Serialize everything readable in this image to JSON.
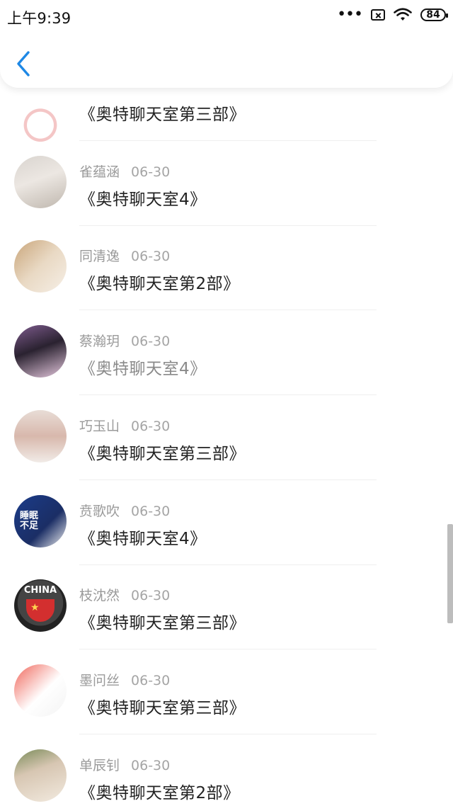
{
  "status_bar": {
    "time": "上午9:39",
    "battery": "84",
    "dots": "•••"
  },
  "nav": {
    "back_icon": "chevron-left-icon",
    "accent_color": "#1e88e5"
  },
  "list": {
    "items": [
      {
        "author": "",
        "date": "",
        "title": "《奥特聊天室第三部》",
        "avatar_text": ""
      },
      {
        "author": "雀蕴涵",
        "date": "06-30",
        "title": "《奥特聊天室4》",
        "avatar_text": ""
      },
      {
        "author": "同清逸",
        "date": "06-30",
        "title": "《奥特聊天室第2部》",
        "avatar_text": ""
      },
      {
        "author": "蔡瀚玥",
        "date": "06-30",
        "title": "《奥特聊天室4》",
        "avatar_text": ""
      },
      {
        "author": "巧玉山",
        "date": "06-30",
        "title": "《奥特聊天室第三部》",
        "avatar_text": ""
      },
      {
        "author": "贲歌吹",
        "date": "06-30",
        "title": "《奥特聊天室4》",
        "avatar_text": "睡眠不足"
      },
      {
        "author": "枝沈然",
        "date": "06-30",
        "title": "《奥特聊天室第三部》",
        "avatar_text": "CHINA"
      },
      {
        "author": "墨问丝",
        "date": "06-30",
        "title": "《奥特聊天室第三部》",
        "avatar_text": ""
      },
      {
        "author": "单辰钊",
        "date": "06-30",
        "title": "《奥特聊天室第2部》",
        "avatar_text": ""
      }
    ]
  }
}
